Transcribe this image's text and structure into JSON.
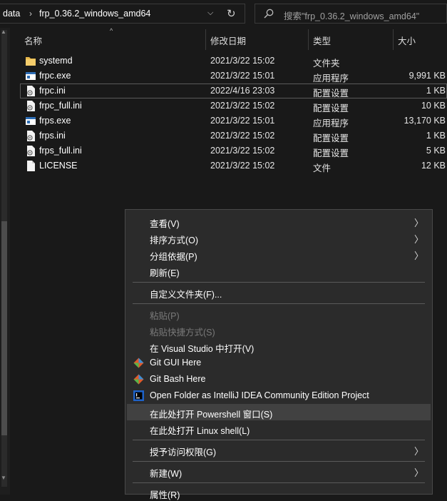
{
  "address": {
    "crumbs": [
      "data",
      "frp_0.36.2_windows_amd64"
    ],
    "search_placeholder": "搜索\"frp_0.36.2_windows_amd64\""
  },
  "columns": {
    "name": "名称",
    "date": "修改日期",
    "type": "类型",
    "size": "大小"
  },
  "files": [
    {
      "name": "systemd",
      "date": "2021/3/22 15:02",
      "type": "文件夹",
      "size": "",
      "icon": "folder-icon"
    },
    {
      "name": "frpc.exe",
      "date": "2021/3/22 15:01",
      "type": "应用程序",
      "size": "9,991 KB",
      "icon": "exe-icon"
    },
    {
      "name": "frpc.ini",
      "date": "2022/4/16 23:03",
      "type": "配置设置",
      "size": "1 KB",
      "icon": "ini-file-icon",
      "selected": true
    },
    {
      "name": "frpc_full.ini",
      "date": "2021/3/22 15:02",
      "type": "配置设置",
      "size": "10 KB",
      "icon": "ini-file-icon"
    },
    {
      "name": "frps.exe",
      "date": "2021/3/22 15:01",
      "type": "应用程序",
      "size": "13,170 KB",
      "icon": "exe-icon"
    },
    {
      "name": "frps.ini",
      "date": "2021/3/22 15:02",
      "type": "配置设置",
      "size": "1 KB",
      "icon": "ini-file-icon"
    },
    {
      "name": "frps_full.ini",
      "date": "2021/3/22 15:02",
      "type": "配置设置",
      "size": "5 KB",
      "icon": "ini-file-icon"
    },
    {
      "name": "LICENSE",
      "date": "2021/3/22 15:02",
      "type": "文件",
      "size": "12 KB",
      "icon": "file-icon"
    }
  ],
  "menu": {
    "view": "查看(V)",
    "sort_by": "排序方式(O)",
    "group_by": "分组依据(P)",
    "refresh": "刷新(E)",
    "customize_folder": "自定义文件夹(F)...",
    "paste": "粘贴(P)",
    "paste_shortcut": "粘贴快捷方式(S)",
    "open_in_vs": "在 Visual Studio 中打开(V)",
    "git_gui": "Git GUI Here",
    "git_bash": "Git Bash Here",
    "open_intellij": "Open Folder as IntelliJ IDEA Community Edition Project",
    "open_powershell": "在此处打开 Powershell 窗口(S)",
    "open_linux_shell": "在此处打开 Linux shell(L)",
    "give_access": "授予访问权限(G)",
    "new": "新建(W)",
    "properties": "属性(R)"
  },
  "colors": {
    "background": "#191919",
    "menu_background": "#2b2b2b",
    "menu_hover": "#414141",
    "folder": "#e8b84a",
    "exe": "#2d6db5"
  }
}
